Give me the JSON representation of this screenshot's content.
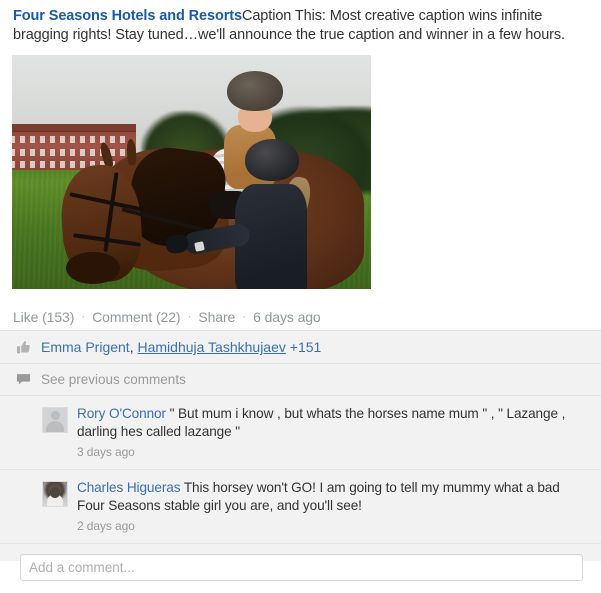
{
  "post": {
    "brand_name": "Four Seasons Hotels and Resorts",
    "message": "Caption This: Most creative caption wins infinite bragging rights! Stay tuned…we'll announce the true caption and winner in a few hours.",
    "photo_alt": "Young girl in a riding helmet sitting on a brown horse in a green field with a red brick mansion in the background, while an instructor in a black helmet holds the reins"
  },
  "actions": {
    "like_label": "Like (153)",
    "comment_label": "Comment (22)",
    "share_label": "Share",
    "timestamp": "6 days ago",
    "separator": "·"
  },
  "likes": {
    "icon": "thumbs-up-icon",
    "name_1": "Emma Prigent",
    "comma": ", ",
    "name_2": "Hamidhuja Tashkhujaev",
    "more_count": "+151"
  },
  "previous_comments": {
    "icon": "comment-bubble-icon",
    "label": "See previous comments"
  },
  "comments": [
    {
      "avatar_type": "silhouette",
      "author": "Rory O'Connor",
      "text": " \" But mum i know , but whats the horses name mum \" , \" Lazange , darling hes called lazange \"",
      "time": "3 days ago"
    },
    {
      "avatar_type": "photo",
      "author": "Charles Higueras",
      "text": " This horsey won't GO! I am going to tell my mummy what a bad Four Seasons stable girl you are, and you'll see!",
      "time": "2 days ago"
    }
  ],
  "composer": {
    "placeholder": "Add a comment...",
    "value": ""
  },
  "colors": {
    "brand_link": "#1a5aa6",
    "link": "#3b6fb5",
    "muted": "#9197a3",
    "text": "#333333",
    "panel_bg": "#f2f2f2"
  }
}
